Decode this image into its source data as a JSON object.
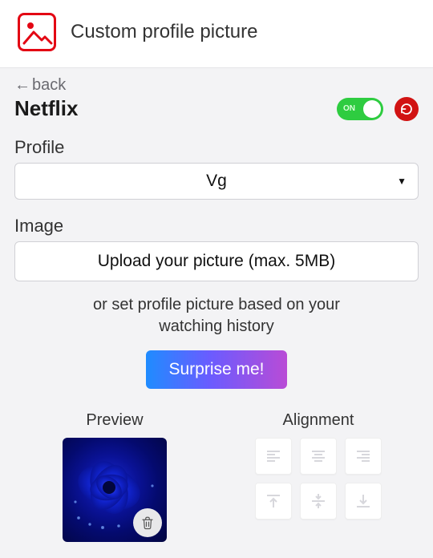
{
  "app": {
    "title": "Custom profile picture"
  },
  "nav": {
    "back_label": "back"
  },
  "site": {
    "name": "Netflix"
  },
  "toggle": {
    "on_label": "ON",
    "state": true
  },
  "profile": {
    "label": "Profile",
    "selected": "Vg"
  },
  "image": {
    "label": "Image",
    "upload_label": "Upload your picture (max. 5MB)",
    "helper_text_line1": "or set profile picture based on your",
    "helper_text_line2": "watching history",
    "surprise_label": "Surprise me!"
  },
  "preview": {
    "label": "Preview"
  },
  "alignment": {
    "label": "Alignment"
  }
}
